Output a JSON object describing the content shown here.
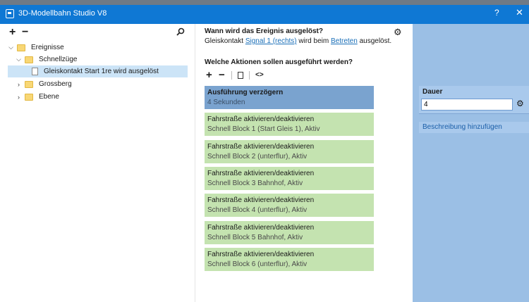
{
  "window": {
    "title": "3D-Modellbahn Studio V8",
    "help": "?",
    "close": "✕"
  },
  "tree": {
    "add": "+",
    "remove": "−",
    "items": [
      {
        "label": "Ereignisse",
        "expanded": true,
        "level": 0,
        "icon": "folder-icon"
      },
      {
        "label": "Schnellzüge",
        "expanded": true,
        "level": 1,
        "icon": "folder-icon"
      },
      {
        "label": "Gleiskontakt Start 1re wird ausgelöst",
        "level": 2,
        "icon": "document-icon",
        "selected": true
      },
      {
        "label": "Grossberg",
        "expanded": false,
        "level": 0,
        "icon": "folder-icon"
      },
      {
        "label": "Ebene",
        "expanded": false,
        "level": 0,
        "icon": "folder-icon"
      }
    ]
  },
  "trigger": {
    "question": "Wann wird das Ereignis ausgelöst?",
    "prefix": "Gleiskontakt",
    "link1": "Signal 1 (rechts)",
    "middle": "wird beim",
    "link2": "Betreten",
    "suffix": "ausgelöst."
  },
  "actions": {
    "question": "Welche Aktionen sollen ausgeführt werden?",
    "add": "+",
    "remove": "−",
    "code": "<>",
    "items": [
      {
        "title": "Ausführung verzögern",
        "detail": "4 Sekunden",
        "kind": "delay"
      },
      {
        "title": "Fahrstraße aktivieren/deaktivieren",
        "detail": "Schnell Block 1 (Start Gleis 1), Aktiv",
        "kind": "route"
      },
      {
        "title": "Fahrstraße aktivieren/deaktivieren",
        "detail": "Schnell Block 2 (unterflur), Aktiv",
        "kind": "route"
      },
      {
        "title": "Fahrstraße aktivieren/deaktivieren",
        "detail": "Schnell Block 3 Bahnhof, Aktiv",
        "kind": "route"
      },
      {
        "title": "Fahrstraße aktivieren/deaktivieren",
        "detail": "Schnell Block 4 (unterflur), Aktiv",
        "kind": "route"
      },
      {
        "title": "Fahrstraße aktivieren/deaktivieren",
        "detail": "Schnell Block 5 Bahnhof, Aktiv",
        "kind": "route"
      },
      {
        "title": "Fahrstraße aktivieren/deaktivieren",
        "detail": "Schnell Block 6 (unterflur), Aktiv",
        "kind": "route"
      }
    ]
  },
  "properties": {
    "dauer_label": "Dauer",
    "dauer_value": "4",
    "description_link": "Beschreibung hinzufügen"
  },
  "colors": {
    "titlebar": "#0f78d4",
    "delay_action": "#7aa3cf",
    "route_action": "#c4e3b0",
    "right_panel": "#9bbfe5",
    "selection": "#cce4f7"
  }
}
